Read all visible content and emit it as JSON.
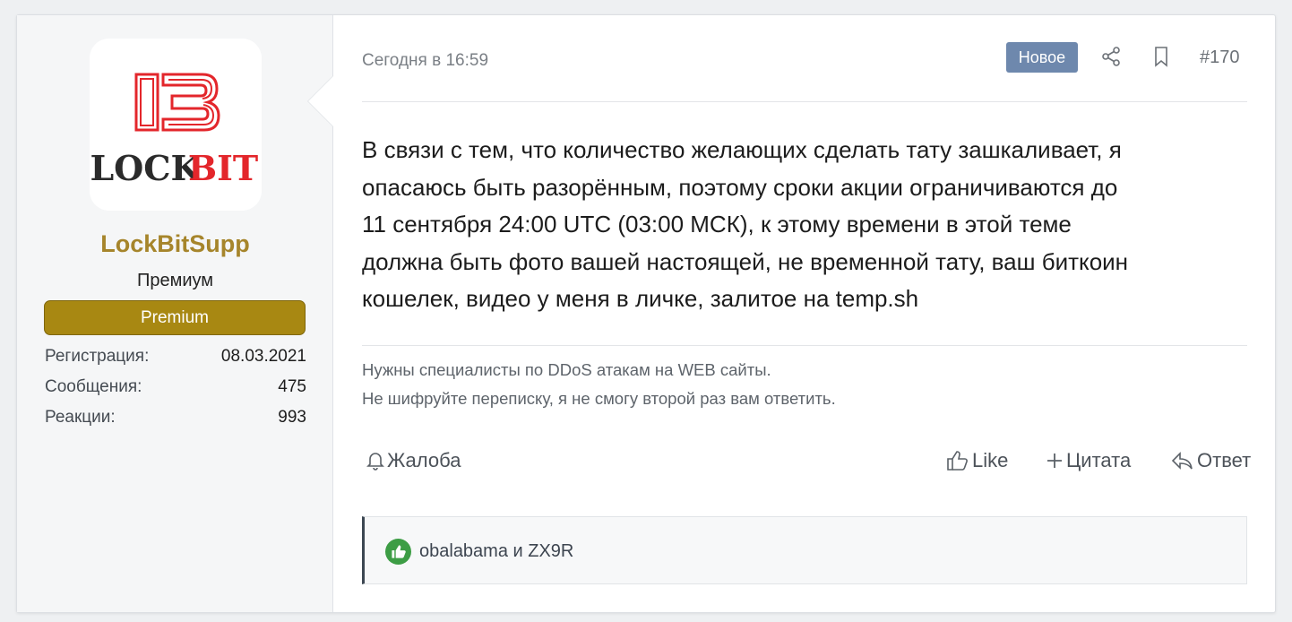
{
  "user": {
    "avatar_text": "LOCKBIT",
    "name": "LockBitSupp",
    "title": "Премиум",
    "banner": "Premium",
    "stats": [
      {
        "label": "Регистрация:",
        "value": "08.03.2021"
      },
      {
        "label": "Сообщения:",
        "value": "475"
      },
      {
        "label": "Реакции:",
        "value": "993"
      }
    ]
  },
  "post": {
    "date": "Сегодня в 16:59",
    "badge": "Новое",
    "number": "#170",
    "body_lines": [
      "В связи с тем, что количество желающих сделать тату зашкаливает, я",
      "опасаюсь быть разорённым, поэтому сроки акции ограничиваются до",
      "11 сентября 24:00 UTC (03:00 МСК), к этому времени в этой теме",
      "должна быть фото вашей настоящей, не временной тату, ваш биткоин",
      "кошелек, видео у меня в личке, залитое на temp.sh"
    ],
    "signature_lines": [
      "Нужны специалисты по DDoS атакам на WEB сайты.",
      "Не шифруйте переписку, я не смогу второй раз вам ответить."
    ]
  },
  "actions": {
    "report": "Жалоба",
    "like": "Like",
    "quote": "Цитата",
    "reply": "Ответ"
  },
  "reactions": {
    "users": "obalabama и ZX9R"
  },
  "colors": {
    "username": "#a6852b",
    "banner": "#a88812",
    "new_badge": "#6e88ad",
    "like_reaction": "#3d9d45",
    "logo_red": "#e3262b"
  },
  "icons": [
    "share-icon",
    "bookmark-icon",
    "bell-icon",
    "thumbs-up-icon",
    "plus-icon",
    "reply-arrow-icon",
    "like-reaction-icon"
  ]
}
